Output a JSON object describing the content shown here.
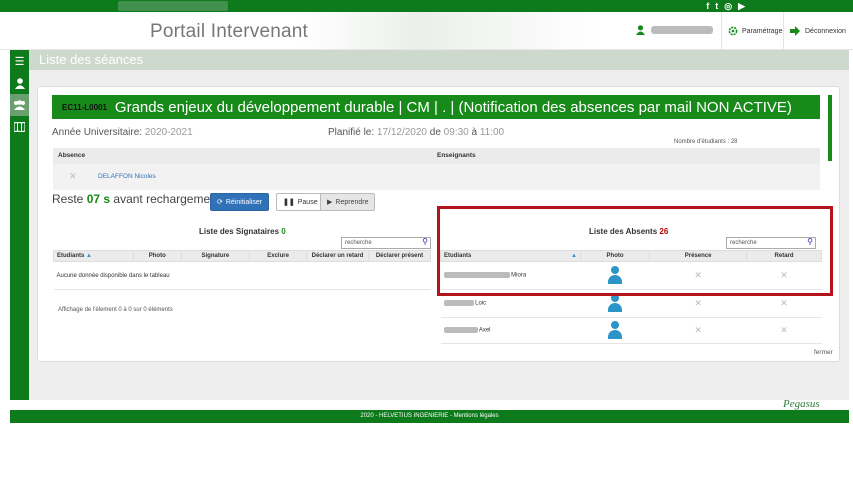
{
  "app": {
    "title": "Portail Intervenant"
  },
  "header": {
    "settings_label": "Paramétrage",
    "logout_label": "Déconnexion"
  },
  "page": {
    "title": "Liste des séances"
  },
  "course": {
    "code": "EC11-L0001",
    "title": "Grands enjeux du développement durable | CM | . | (Notification des absences par mail NON ACTIVE)",
    "year_label": "Année Universitaire:",
    "year_value": "2020-2021",
    "planned_label": "Planifié le:",
    "planned_date": "17/12/2020",
    "planned_from": "de",
    "planned_start": "09:30",
    "planned_to": "à",
    "planned_end": "11:00",
    "students_count_text": "Nombre d'étudiants : 28"
  },
  "top_grid": {
    "col_absence": "Absence",
    "col_teachers": "Enseignants",
    "teacher_name": "DELAFFON Nicoles"
  },
  "reload": {
    "prefix": "Reste",
    "seconds": "07 s",
    "suffix": "avant rechargement",
    "reset_label": "Réinitialiser",
    "pause_label": "Pause",
    "resume_label": "Reprendre"
  },
  "signataires": {
    "title": "Liste des Signataires",
    "count": "0",
    "search_placeholder": "recherche",
    "columns": [
      "Etudiants",
      "Photo",
      "Signature",
      "Exclure",
      "Déclarer un retard",
      "Déclarer présent"
    ],
    "empty": "Aucune donnée disponible dans le tableau",
    "info": "Affichage de l'élement 0 à 0 sur 0 éléments"
  },
  "absents": {
    "title": "Liste des Absents",
    "count": "26",
    "search_placeholder": "recherche",
    "columns": [
      "Etudiants",
      "Photo",
      "Présence",
      "Retard"
    ],
    "rows": [
      {
        "name": "Miora"
      },
      {
        "name": "Loic"
      },
      {
        "name": "Axel"
      }
    ]
  },
  "close_label": "fermer",
  "footer": {
    "text": "2020 - HELVETIUS INGENIERIE - Mentions légales"
  },
  "logo_text": "Pegasus",
  "colors": {
    "brand_green": "#0d7a1c",
    "primary_blue": "#2f72b7",
    "highlight_red": "#b3131a",
    "avatar_blue": "#2a95c6"
  }
}
